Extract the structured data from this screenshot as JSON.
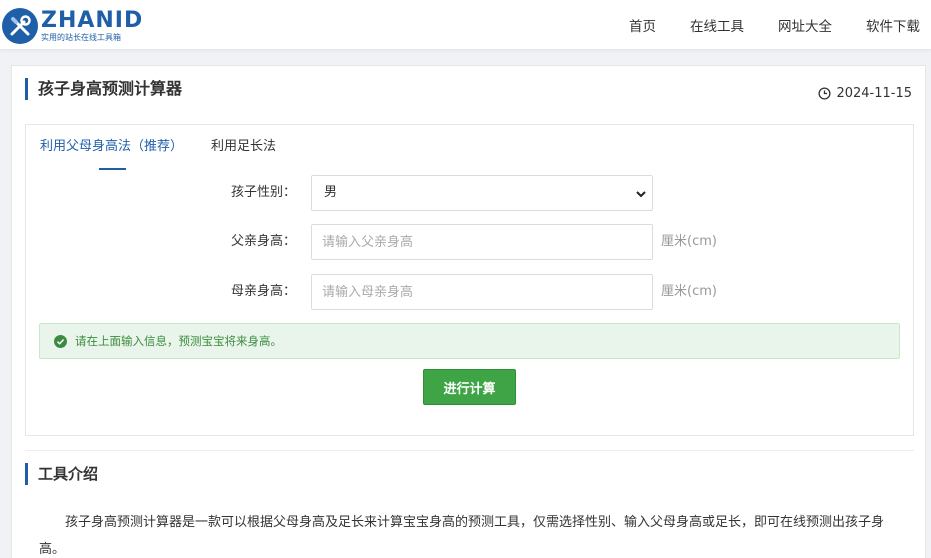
{
  "header": {
    "logo_word": "ZHANID",
    "logo_slogan": "实用的站长在线工具箱",
    "nav": [
      "首页",
      "在线工具",
      "网址大全",
      "软件下载"
    ]
  },
  "page": {
    "title": "孩子身高预测计算器",
    "date": "2024-11-15"
  },
  "tabs": [
    {
      "label": "利用父母身高法（推荐）",
      "active": true
    },
    {
      "label": "利用足长法",
      "active": false
    }
  ],
  "form": {
    "gender_label": "孩子性别：",
    "gender_value": "男",
    "father_label": "父亲身高：",
    "father_placeholder": "请输入父亲身高",
    "mother_label": "母亲身高：",
    "mother_placeholder": "请输入母亲身高",
    "unit": "厘米(cm)",
    "alert": "请在上面输入信息，预测宝宝将来身高。",
    "submit": "进行计算"
  },
  "intro": {
    "title": "工具介绍",
    "text": "孩子身高预测计算器是一款可以根据父母身高及足长来计算宝宝身高的预测工具，仅需选择性别、输入父母身高或足长，即可在线预测出孩子身高。"
  },
  "colors": {
    "brand": "#1f5fa8",
    "success": "#3ea446",
    "alert_bg": "#e9f5ea"
  }
}
